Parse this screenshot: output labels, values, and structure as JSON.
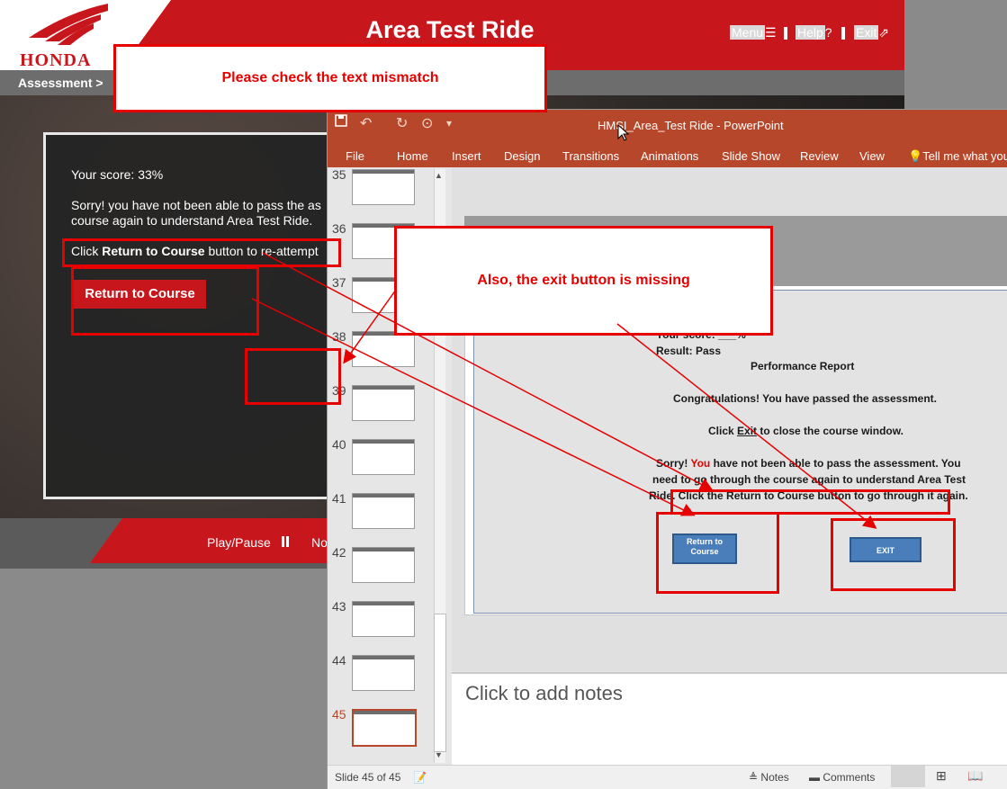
{
  "course": {
    "logo_text": "HONDA",
    "title": "Area Test Ride",
    "nav": {
      "menu": "Menu",
      "menu_icon": "☰",
      "help": "Help",
      "help_icon": "?",
      "exit": "Exit",
      "exit_icon": "⇗"
    },
    "breadcrumb": "Assessment >",
    "score": "Your score: 33%",
    "message_line1": "Sorry! you have not been able to pass the as",
    "message_line2": "course again to understand Area Test Ride.",
    "instruction_pre": "Click ",
    "instruction_bold": "Return to Course",
    "instruction_post": " button to re-attempt",
    "return_button": "Return to Course",
    "footer_playpause": "Play/Pause",
    "footer_next": "No"
  },
  "ppt": {
    "window_title": "HMSI_Area_Test Ride - PowerPoint",
    "ribbon_tabs": [
      "File",
      "Home",
      "Insert",
      "Design",
      "Transitions",
      "Animations",
      "Slide Show",
      "Review",
      "View"
    ],
    "tell_me": "Tell me what you",
    "slide_numbers": [
      "35",
      "36",
      "37",
      "38",
      "39",
      "40",
      "41",
      "42",
      "43",
      "44",
      "45"
    ],
    "selected_slide": "45",
    "slide": {
      "score": "Your score: ___%",
      "result": "Result: Pass",
      "report_title": "Performance Report",
      "congrats": "Congratulations! You have passed  the assessment.",
      "click_exit_pre": "Click ",
      "click_exit_bold": "Exit",
      "click_exit_post": " to close the course window.",
      "sorry_line1_a": "Sorry! ",
      "sorry_line1_red": "You",
      "sorry_line1_b": " have not been able to pass the assessment. You",
      "sorry_line2": "need to go through the course again to understand Area Test",
      "sorry_line3": "Ride. Click the Return to Course button to go through it again.",
      "btn_return": "Return to Course",
      "btn_exit": "EXIT"
    },
    "notes_placeholder": "Click to add notes",
    "status_slide": "Slide 45 of 45",
    "status_notes": "Notes",
    "status_comments": "Comments"
  },
  "annotations": {
    "callout_top": "Please check the text mismatch",
    "callout_mid": "Also, the exit button is missing"
  },
  "colors": {
    "honda_red": "#c8161d",
    "ppt_orange": "#b7472a",
    "annotation_red": "#e60000"
  }
}
